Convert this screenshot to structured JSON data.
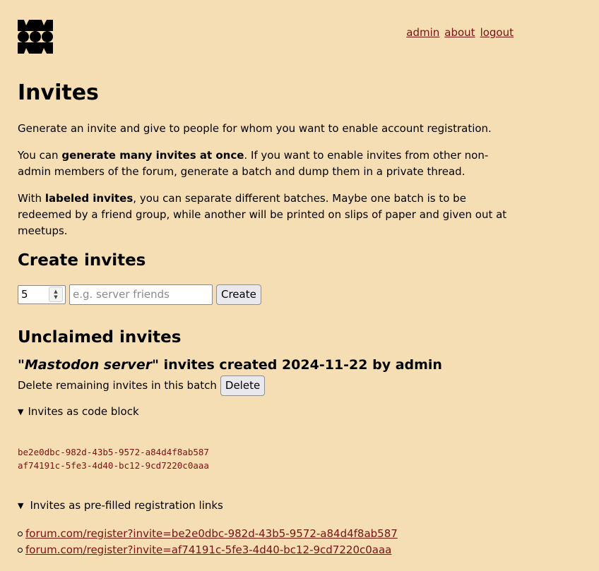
{
  "nav": {
    "admin": "admin",
    "about": "about",
    "logout": "logout"
  },
  "page": {
    "title": "Invites",
    "p1": "Generate an invite and give to people for whom you want to enable account registration.",
    "p2_pre": "You can ",
    "p2_bold": "generate many invites at once",
    "p2_post": ". If you want to enable invites from other non-admin members of the forum, generate a batch and dump them in a private thread.",
    "p3_pre": "With ",
    "p3_bold": "labeled invites",
    "p3_post": ", you can separate different batches. Maybe one batch is to be redeemed by a friend group, while another will be printed on slips of paper and given out at meetups."
  },
  "create": {
    "heading": "Create invites",
    "count_value": "5",
    "label_placeholder": "e.g. server friends",
    "button": "Create"
  },
  "unclaimed": {
    "heading": "Unclaimed invites",
    "batch": {
      "label": "\"Mastodon server\"",
      "mid": " invites created 2024-11-22 by ",
      "author": "admin",
      "delete_text": "Delete remaining invites in this batch",
      "delete_button": "Delete",
      "code_summary": "Invites as code block",
      "codes": [
        "be2e0dbc-982d-43b5-9572-a84d4f8ab587",
        "af74191c-5fe3-4d40-bc12-9cd7220c0aaa"
      ],
      "links_summary": "Invites as pre-filled registration links",
      "links": [
        "forum.com/register?invite=be2e0dbc-982d-43b5-9572-a84d4f8ab587",
        "forum.com/register?invite=af74191c-5fe3-4d40-bc12-9cd7220c0aaa"
      ]
    }
  }
}
